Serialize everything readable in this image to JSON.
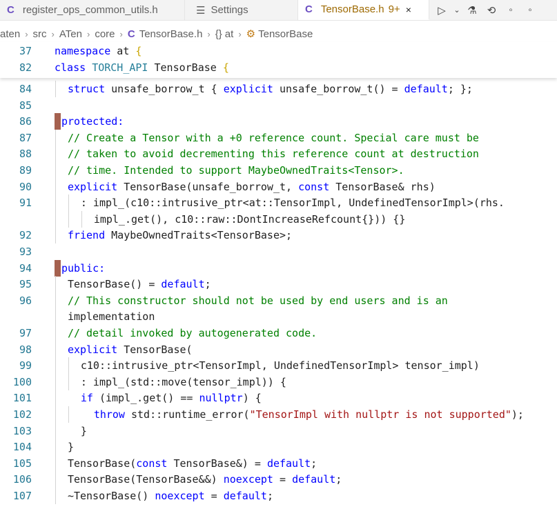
{
  "tabs": [
    {
      "label": "register_ops_common_utils.h",
      "icon": "c-file-icon"
    },
    {
      "label": "Settings",
      "icon": "settings-icon"
    },
    {
      "label": "TensorBase.h",
      "icon": "c-file-icon",
      "badge": "9+",
      "close": "×",
      "active": true
    }
  ],
  "breadcrumb": [
    "aten",
    "src",
    "ATen",
    "core",
    "TensorBase.h",
    "at",
    "TensorBase"
  ],
  "sticky": [
    {
      "ln": "37",
      "code": "namespace at {"
    },
    {
      "ln": "82",
      "code": "class TORCH_API TensorBase {"
    }
  ],
  "lines": [
    {
      "ln": "84",
      "code": "struct unsafe_borrow_t { explicit unsafe_borrow_t() = default; };"
    },
    {
      "ln": "85",
      "code": ""
    },
    {
      "ln": "86",
      "code": "protected:"
    },
    {
      "ln": "87",
      "code": "// Create a Tensor with a +0 reference count. Special care must be"
    },
    {
      "ln": "88",
      "code": "// taken to avoid decrementing this reference count at destruction"
    },
    {
      "ln": "89",
      "code": "// time. Intended to support MaybeOwnedTraits<Tensor>."
    },
    {
      "ln": "90",
      "code": "explicit TensorBase(unsafe_borrow_t, const TensorBase& rhs)"
    },
    {
      "ln": "91",
      "code": ": impl_(c10::intrusive_ptr<at::TensorImpl, UndefinedTensorImpl>(rhs."
    },
    {
      "ln": "",
      "code": "impl_.get(), c10::raw::DontIncreaseRefcount{})) {}"
    },
    {
      "ln": "92",
      "code": "friend MaybeOwnedTraits<TensorBase>;"
    },
    {
      "ln": "93",
      "code": ""
    },
    {
      "ln": "94",
      "code": "public:"
    },
    {
      "ln": "95",
      "code": "TensorBase() = default;"
    },
    {
      "ln": "96",
      "code": "// This constructor should not be used by end users and is an"
    },
    {
      "ln": "",
      "code": "implementation"
    },
    {
      "ln": "97",
      "code": "// detail invoked by autogenerated code."
    },
    {
      "ln": "98",
      "code": "explicit TensorBase("
    },
    {
      "ln": "99",
      "code": "c10::intrusive_ptr<TensorImpl, UndefinedTensorImpl> tensor_impl)"
    },
    {
      "ln": "100",
      "code": ": impl_(std::move(tensor_impl)) {"
    },
    {
      "ln": "101",
      "code": "if (impl_.get() == nullptr) {"
    },
    {
      "ln": "102",
      "code": "throw std::runtime_error(\"TensorImpl with nullptr is not supported\");"
    },
    {
      "ln": "103",
      "code": "}"
    },
    {
      "ln": "104",
      "code": "}"
    },
    {
      "ln": "105",
      "code": "TensorBase(const TensorBase&) = default;"
    },
    {
      "ln": "106",
      "code": "TensorBase(TensorBase&&) noexcept = default;"
    },
    {
      "ln": "107",
      "code": "~TensorBase() noexcept = default;"
    }
  ],
  "colors": {
    "keyword": "#0000ff",
    "type": "#267f99",
    "comment": "#008000",
    "string": "#a31515",
    "line_number": "#237893",
    "access_marker": "#a5614f"
  }
}
